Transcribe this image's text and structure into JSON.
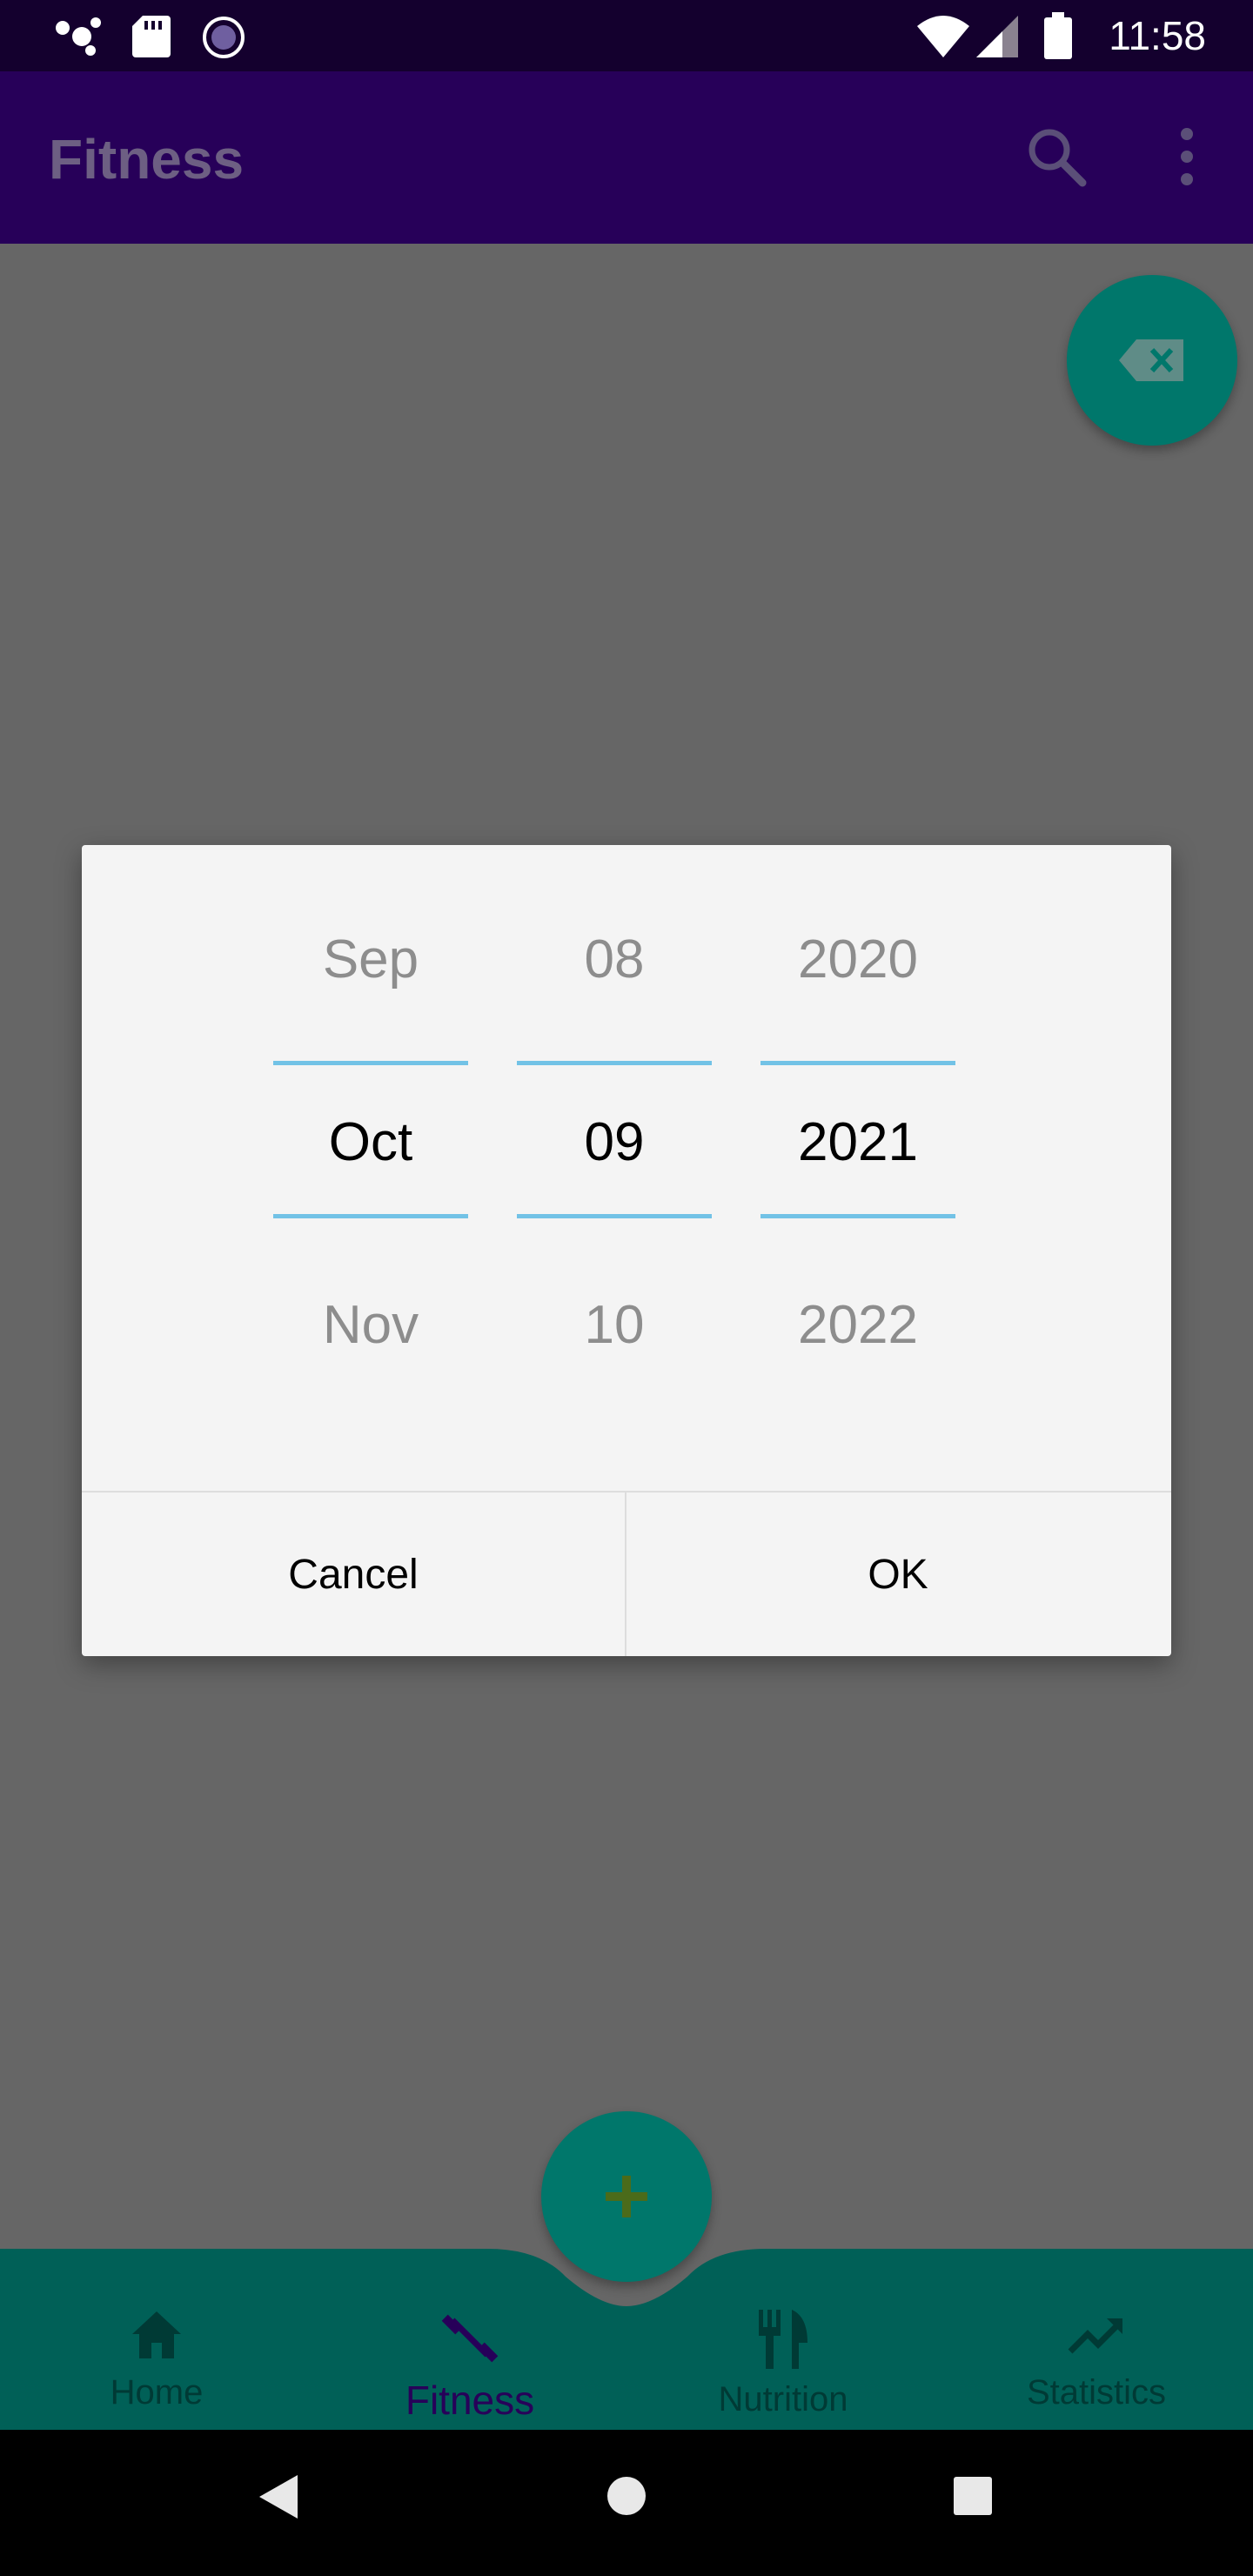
{
  "status_bar": {
    "time": "11:58",
    "icons": [
      "notification-dots-icon",
      "sd-card-icon",
      "sync-circle-icon",
      "wifi-icon",
      "cell-signal-icon",
      "battery-icon"
    ]
  },
  "app_bar": {
    "title": "Fitness",
    "actions": [
      "search-icon",
      "more-vert-icon"
    ]
  },
  "fab_clear": {
    "icon": "backspace-icon"
  },
  "fab_add": {
    "icon": "plus-icon"
  },
  "dialog": {
    "month": {
      "prev": "Sep",
      "current": "Oct",
      "next": "Nov"
    },
    "day": {
      "prev": "08",
      "current": "09",
      "next": "10"
    },
    "year": {
      "prev": "2020",
      "current": "2021",
      "next": "2022"
    },
    "cancel_label": "Cancel",
    "ok_label": "OK"
  },
  "bottom_nav": {
    "items": [
      {
        "label": "Home",
        "icon": "home-icon",
        "active": false
      },
      {
        "label": "Fitness",
        "icon": "dumbbell-icon",
        "active": true
      },
      {
        "label": "Nutrition",
        "icon": "fork-knife-icon",
        "active": false
      },
      {
        "label": "Statistics",
        "icon": "trending-up-icon",
        "active": false
      }
    ]
  },
  "system_nav": [
    "back-icon",
    "home-circle-icon",
    "recents-square-icon"
  ],
  "colors": {
    "status_bar": "#14002e",
    "app_bar": "#270059",
    "accent_teal": "#00776b",
    "picker_line": "#72c2e6",
    "scrim": "#666666"
  }
}
